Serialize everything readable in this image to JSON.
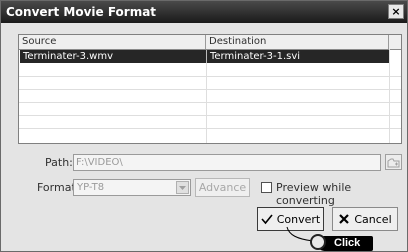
{
  "window": {
    "title": "Convert Movie Format",
    "close_symbol": "×"
  },
  "file_table": {
    "columns": [
      "Source",
      "Destination"
    ],
    "rows": [
      {
        "source": "Terminater-3.wmv",
        "destination": "Terminater-3-1.svi",
        "selected": true
      }
    ]
  },
  "path": {
    "label": "Path:",
    "value": "F:\\VIDEO\\"
  },
  "format": {
    "label": "Format:",
    "selected": "YP-T8"
  },
  "advance_button": {
    "label": "Advance",
    "enabled": false
  },
  "preview_checkbox": {
    "label": "Preview while converting",
    "checked": false
  },
  "convert_button": {
    "label": "Convert",
    "icon": "checkmark-icon"
  },
  "cancel_button": {
    "label": "Cancel",
    "icon": "x-icon"
  },
  "callout": {
    "label": "Click"
  },
  "colors": {
    "title_bar": "#2a2a2a",
    "selection": "#262626",
    "dialog_bg": "#e4e4e4"
  }
}
